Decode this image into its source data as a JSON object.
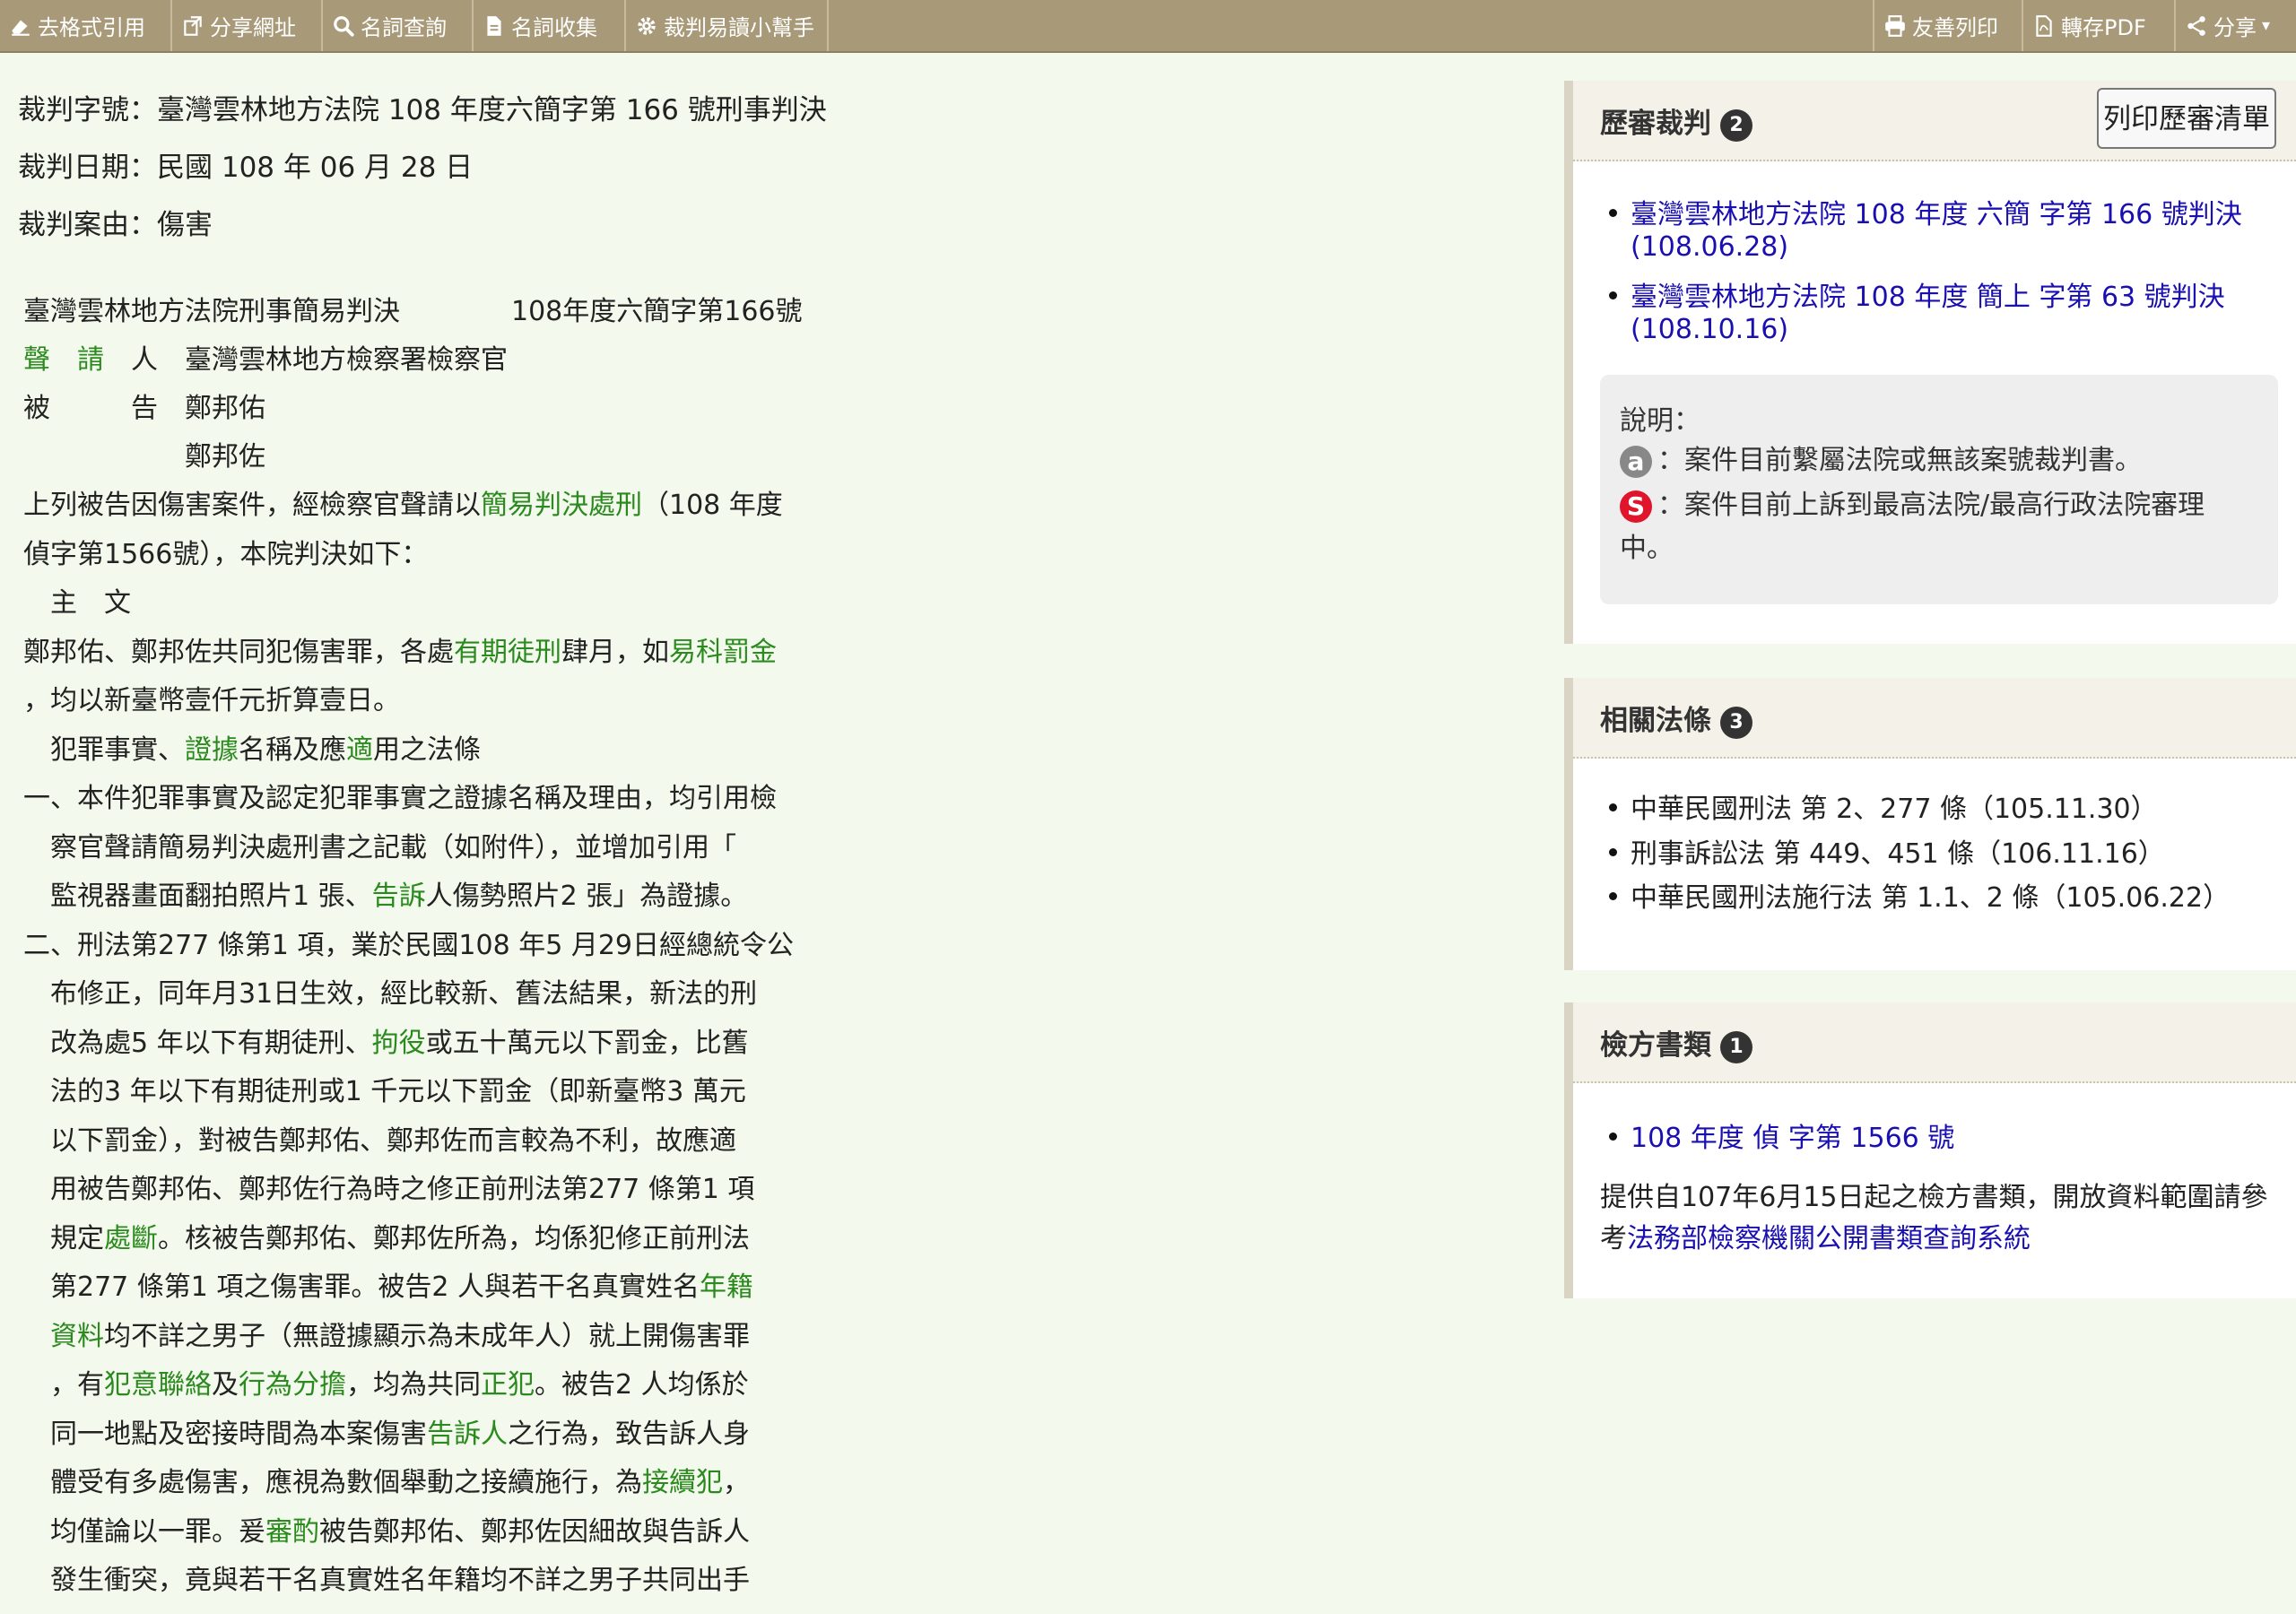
{
  "toolbar": {
    "left": [
      {
        "label": "去格式引用",
        "icon": "eraser-icon"
      },
      {
        "label": "分享網址",
        "icon": "share-link-icon"
      },
      {
        "label": "名詞查詢",
        "icon": "search-icon"
      },
      {
        "label": "名詞收集",
        "icon": "document-icon"
      },
      {
        "label": "裁判易讀小幫手",
        "icon": "gear-icon"
      }
    ],
    "right": [
      {
        "label": "友善列印",
        "icon": "printer-icon"
      },
      {
        "label": "轉存PDF",
        "icon": "pdf-icon"
      },
      {
        "label": "分享",
        "icon": "share-icon"
      }
    ]
  },
  "meta": {
    "case_no": "裁判字號：臺灣雲林地方法院 108 年度六簡字第 166 號刑事判決",
    "date": "裁判日期：民國 108 年 06 月 28 日",
    "cause": "裁判案由：傷害"
  },
  "document": {
    "court_header": "臺灣雲林地方法院刑事簡易判決",
    "case_header": "108年度六簡字第166號",
    "party1_role_a": "聲　請",
    "party1_role_b": "人",
    "party1_name": "臺灣雲林地方檢察署檢察官",
    "party2_role_a": "被",
    "party2_role_b": "告",
    "party2_name": "鄭邦佑",
    "party3_name": "鄭邦佐",
    "lines": [
      [
        {
          "t": "上列被告因傷害案件，經檢察官聲請以"
        },
        {
          "t": "簡易判決處刑",
          "k": 1
        },
        {
          "t": "（108 年度"
        }
      ],
      [
        {
          "t": "偵字第1566號），本院判決如下："
        }
      ],
      [
        {
          "t": "　主　文"
        }
      ],
      [
        {
          "t": "鄭邦佑、鄭邦佐共同犯傷害罪，各處"
        },
        {
          "t": "有期徒刑",
          "k": 1
        },
        {
          "t": "肆月，如"
        },
        {
          "t": "易科罰金",
          "k": 1
        }
      ],
      [
        {
          "t": "，均以新臺幣壹仟元折算壹日。"
        }
      ],
      [
        {
          "t": "　犯罪事實、"
        },
        {
          "t": "證據",
          "k": 1
        },
        {
          "t": "名稱及應"
        },
        {
          "t": "適",
          "k": 1
        },
        {
          "t": "用之法條"
        }
      ],
      [
        {
          "t": "一、本件犯罪事實及認定犯罪事實之證據名稱及理由，均引用檢"
        }
      ],
      [
        {
          "t": "　察官聲請簡易判決處刑書之記載（如附件），並增加引用「"
        }
      ],
      [
        {
          "t": "　監視器畫面翻拍照片1 張、"
        },
        {
          "t": "告訴",
          "k": 1
        },
        {
          "t": "人傷勢照片2 張」為證據。"
        }
      ],
      [
        {
          "t": "二、刑法第277 條第1 項，業於民國108 年5 月29日經總統令公"
        }
      ],
      [
        {
          "t": "　布修正，同年月31日生效，經比較新、舊法結果，新法的刑"
        }
      ],
      [
        {
          "t": "　改為處5 年以下有期徒刑、"
        },
        {
          "t": "拘役",
          "k": 1
        },
        {
          "t": "或五十萬元以下罰金，比舊"
        }
      ],
      [
        {
          "t": "　法的3 年以下有期徒刑或1 千元以下罰金（即新臺幣3 萬元"
        }
      ],
      [
        {
          "t": "　以下罰金），對被告鄭邦佑、鄭邦佐而言較為不利，故應適"
        }
      ],
      [
        {
          "t": "　用被告鄭邦佑、鄭邦佐行為時之修正前刑法第277 條第1 項"
        }
      ],
      [
        {
          "t": "　規定"
        },
        {
          "t": "處斷",
          "k": 1
        },
        {
          "t": "。核被告鄭邦佑、鄭邦佐所為，均係犯修正前刑法"
        }
      ],
      [
        {
          "t": "　第277 條第1 項之傷害罪。被告2 人與若干名真實姓名"
        },
        {
          "t": "年籍",
          "k": 1
        }
      ],
      [
        {
          "t": "　"
        },
        {
          "t": "資料",
          "k": 1
        },
        {
          "t": "均不詳之男子（無證據顯示為未成年人）就上開傷害罪"
        }
      ],
      [
        {
          "t": "　，有"
        },
        {
          "t": "犯意聯絡",
          "k": 1
        },
        {
          "t": "及"
        },
        {
          "t": "行為分擔",
          "k": 1
        },
        {
          "t": "，均為共同"
        },
        {
          "t": "正犯",
          "k": 1
        },
        {
          "t": "。被告2 人均係於"
        }
      ],
      [
        {
          "t": "　同一地點及密接時間為本案傷害"
        },
        {
          "t": "告訴人",
          "k": 1
        },
        {
          "t": "之行為，致告訴人身"
        }
      ],
      [
        {
          "t": "　體受有多處傷害，應視為數個舉動之接續施行，為"
        },
        {
          "t": "接續犯",
          "k": 1
        },
        {
          "t": "，"
        }
      ],
      [
        {
          "t": "　均僅論以一罪。爰"
        },
        {
          "t": "審酌",
          "k": 1
        },
        {
          "t": "被告鄭邦佑、鄭邦佐因細故與告訴人"
        }
      ],
      [
        {
          "t": "　發生衝突，竟與若干名真實姓名年籍均不詳之男子共同出手"
        }
      ]
    ]
  },
  "panels": {
    "history": {
      "title": "歷審裁判",
      "count": "2",
      "print_label": "列印歷審清單",
      "items": [
        {
          "line1": "臺灣雲林地方法院 108 年度 六簡 字第 166 號判決",
          "line2": "(108.06.28)"
        },
        {
          "line1": "臺灣雲林地方法院 108 年度 簡上 字第 63 號判決",
          "line2": "(108.10.16)"
        }
      ],
      "note_title": "說明：",
      "note_a_icon": "a",
      "note_a_text": "：案件目前繫屬法院或無該案號裁判書。",
      "note_s_icon": "S",
      "note_s_text1": "：案件目前上訴到最高法院/最高行政法院審理",
      "note_s_text2": "中。"
    },
    "laws": {
      "title": "相關法條",
      "count": "3",
      "items": [
        "中華民國刑法 第 2、277 條（105.11.30）",
        "刑事訴訟法 第 449、451 條（106.11.16）",
        "中華民國刑法施行法 第 1.1、2 條（105.06.22）"
      ]
    },
    "prosecutor": {
      "title": "檢方書類",
      "count": "1",
      "item": "108 年度 偵 字第 1566 號",
      "desc1": "提供自107年6月15日起之檢方書類，開放資料範圍請參",
      "desc2_prefix": "考",
      "desc2_link": "法務部檢察機關公開書類查詢系統"
    }
  },
  "colors": {
    "toolbar": "#a89a78",
    "keyword": "#2a8a1e",
    "link": "#1a0fb0",
    "background": "#f3f9ec"
  }
}
